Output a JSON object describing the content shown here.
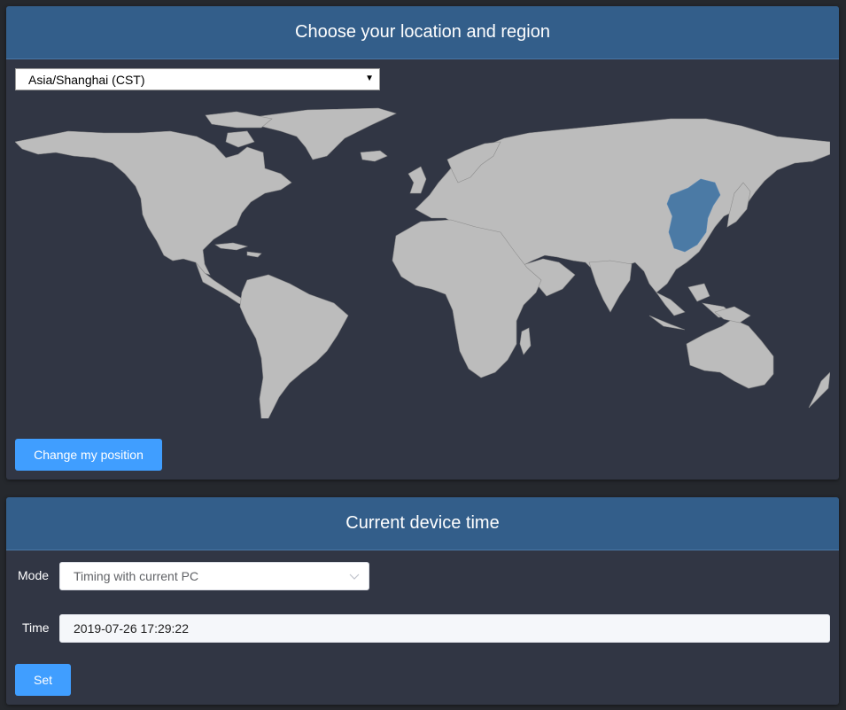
{
  "location": {
    "title": "Choose your location and region",
    "timezone_value": "Asia/Shanghai (CST)",
    "change_button": "Change my position",
    "selected_region": "China"
  },
  "device_time": {
    "title": "Current device time",
    "mode_label": "Mode",
    "mode_value": "Timing with current PC",
    "time_label": "Time",
    "time_value": "2019-07-26 17:29:22",
    "set_button": "Set"
  },
  "colors": {
    "header": "#335e8a",
    "panel": "#313644",
    "land": "#bcbcbc",
    "highlight": "#4b7aa5",
    "button": "#409eff"
  },
  "icons": {
    "timezone_caret": "caret-down-icon",
    "mode_chevron": "chevron-down-icon"
  }
}
